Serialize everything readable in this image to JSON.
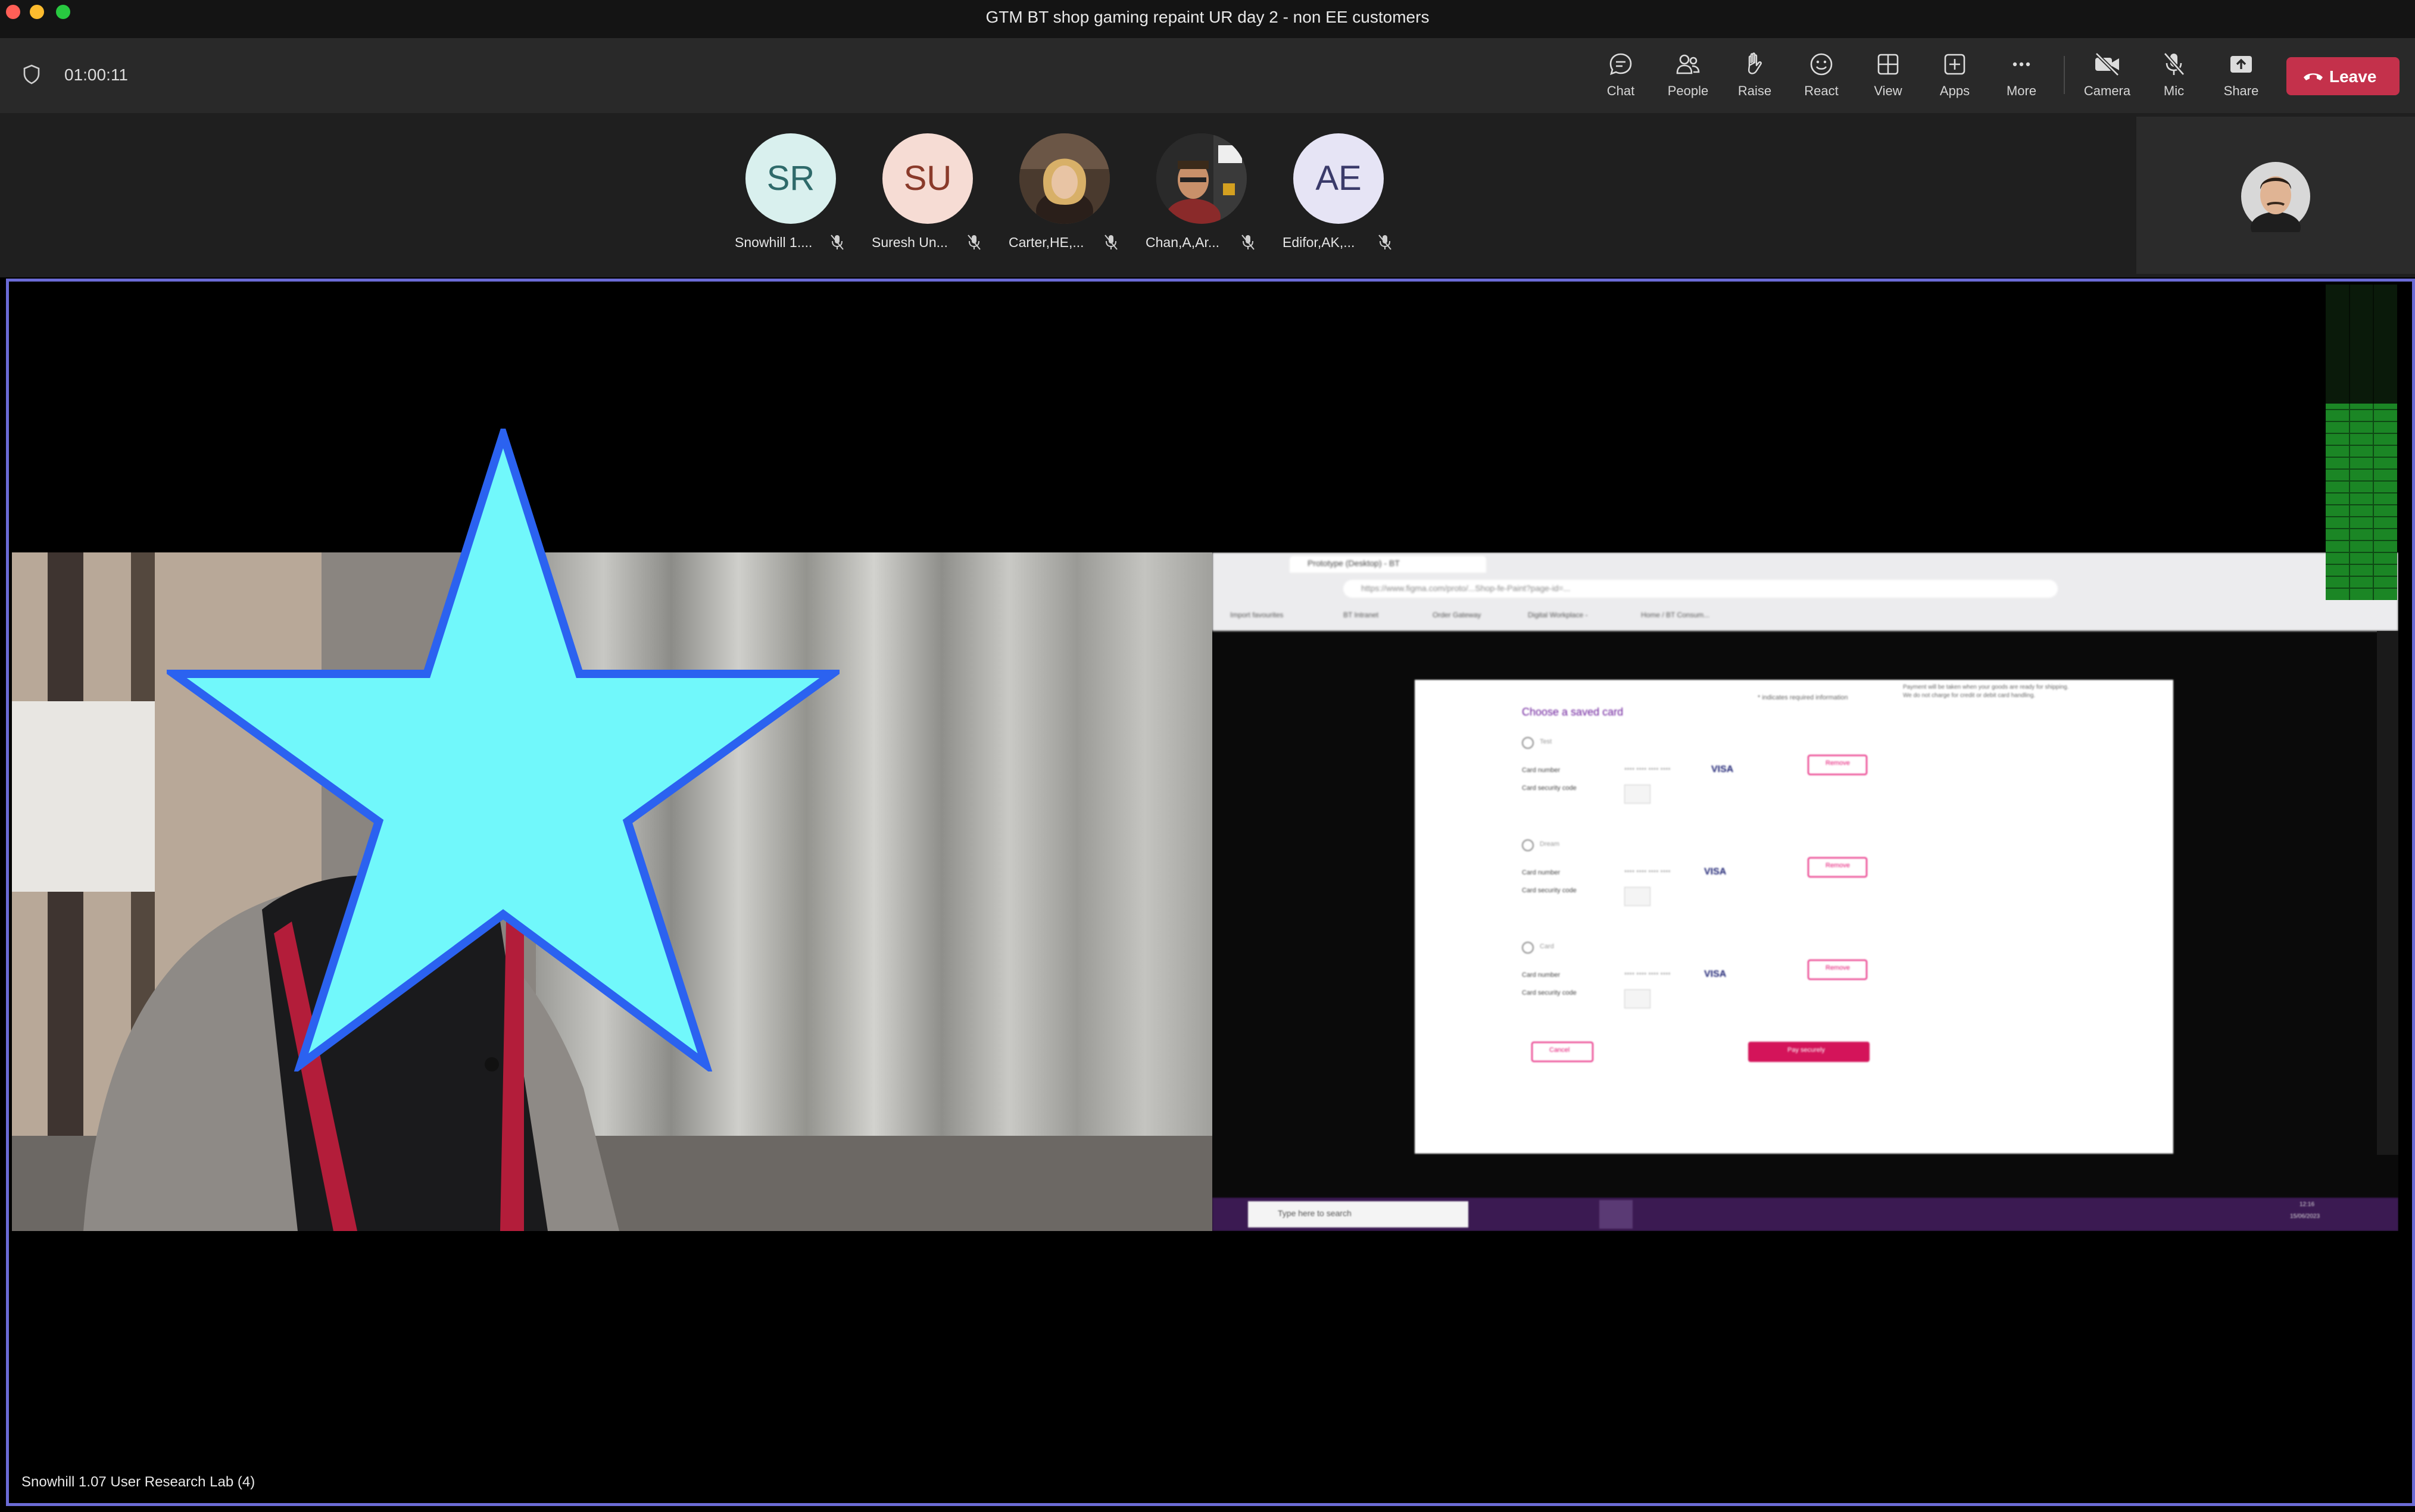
{
  "window": {
    "title": "GTM BT shop gaming repaint UR day 2 - non EE customers",
    "traffic_colors": [
      "#ff5f57",
      "#febc2e",
      "#28c840"
    ]
  },
  "toolbar": {
    "timer": "01:00:11",
    "buttons": [
      {
        "id": "chat",
        "label": "Chat",
        "icon": "chat-icon"
      },
      {
        "id": "people",
        "label": "People",
        "icon": "people-icon"
      },
      {
        "id": "raise",
        "label": "Raise",
        "icon": "raise-hand-icon"
      },
      {
        "id": "react",
        "label": "React",
        "icon": "smiley-icon"
      },
      {
        "id": "view",
        "label": "View",
        "icon": "grid-icon"
      },
      {
        "id": "apps",
        "label": "Apps",
        "icon": "plus-box-icon"
      },
      {
        "id": "more",
        "label": "More",
        "icon": "more-dots-icon"
      },
      {
        "id": "camera",
        "label": "Camera",
        "icon": "camera-off-icon"
      },
      {
        "id": "mic",
        "label": "Mic",
        "icon": "mic-off-icon"
      },
      {
        "id": "share",
        "label": "Share",
        "icon": "share-tray-icon"
      }
    ],
    "leave_label": "Leave",
    "leave_color": "#c4314b"
  },
  "participants": [
    {
      "initials": "SR",
      "name": "Snowhill 1....",
      "bg": "#d9f0ee",
      "fg": "#2e6a6a",
      "muted": true
    },
    {
      "initials": "SU",
      "name": "Suresh Un...",
      "bg": "#f6dcd4",
      "fg": "#8a3a2a",
      "muted": true
    },
    {
      "initials": "",
      "name": "Carter,HE,...",
      "photo": true,
      "muted": true
    },
    {
      "initials": "",
      "name": "Chan,A,Ar...",
      "photo": true,
      "muted": true
    },
    {
      "initials": "AE",
      "name": "Edifor,AK,...",
      "bg": "#e6e4f5",
      "fg": "#3a3a6a",
      "muted": true
    }
  ],
  "stage": {
    "caption": "Snowhill 1.07 User Research Lab (4)",
    "highlight_color": "#6b6bd6"
  },
  "shared_screen": {
    "browser_tab": "Prototype (Desktop) - BT",
    "address": "https://www.figma.com/proto/...Shop-fe-Paint?page-id=...",
    "bookmarks": [
      "Import favourites",
      "BT Intranet",
      "Order Gateway",
      "Digital Workplace -",
      "Home / BT Consum..."
    ],
    "page_heading": "Choose a saved card",
    "required_note": "* indicates required information",
    "side_note": "Payment will be taken when your goods are ready for shipping. We do not charge for credit or debit card handling.",
    "cards": [
      {
        "name": "Test",
        "number_label": "Card number",
        "number": "**** **** **** ****",
        "brand": "VISA",
        "cvv_label": "Card security code",
        "remove": "Remove"
      },
      {
        "name": "Dream",
        "number_label": "Card number",
        "number": "**** **** **** ****",
        "brand": "VISA",
        "cvv_label": "Card security code",
        "remove": "Remove"
      },
      {
        "name": "Card",
        "number_label": "Card number",
        "number": "**** **** **** ****",
        "brand": "VISA",
        "cvv_label": "Card security code",
        "remove": "Remove"
      }
    ],
    "cancel": "Cancel",
    "pay": "Pay securely",
    "taskbar_search": "Type here to search",
    "taskbar_time": "12:16",
    "taskbar_date": "15/06/2023"
  }
}
